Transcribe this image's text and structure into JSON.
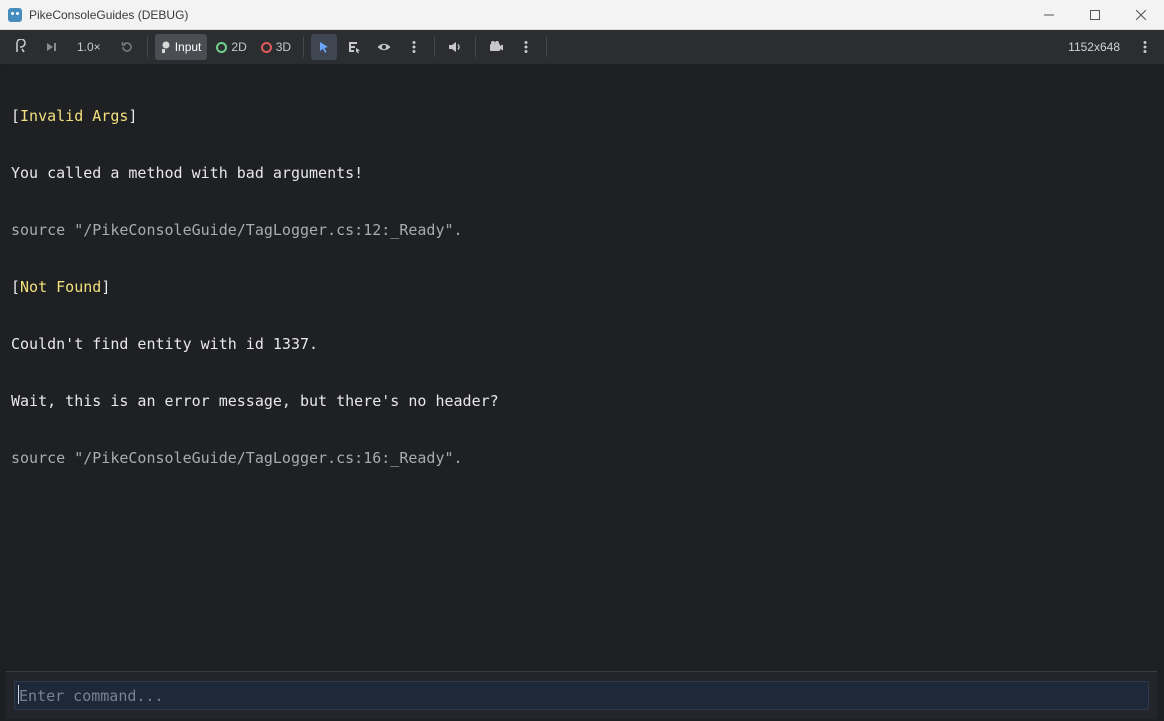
{
  "window": {
    "title": "PikeConsoleGuides (DEBUG)"
  },
  "toolbar": {
    "speed": "1.0×",
    "input_label": "Input",
    "mode_2d_label": "2D",
    "mode_3d_label": "3D",
    "resolution": "1152x648"
  },
  "colors": {
    "header_tag": "#f1e07b",
    "message": "#e8e8e8",
    "source": "#a9abb0",
    "dot_2d": "#6fcf8a",
    "dot_3d": "#e05a5a",
    "select_tool": "#6aa6ff"
  },
  "log": [
    {
      "open": "[",
      "tag": "Invalid Args",
      "close": "]"
    },
    {
      "text": "You called a method with bad arguments!"
    },
    {
      "source": "source \"/PikeConsoleGuide/TagLogger.cs:12:_Ready\"."
    },
    {
      "open": "[",
      "tag": "Not Found",
      "close": "]"
    },
    {
      "text": "Couldn't find entity with id 1337."
    },
    {
      "text": "Wait, this is an error message, but there's no header?"
    },
    {
      "source": "source \"/PikeConsoleGuide/TagLogger.cs:16:_Ready\"."
    }
  ],
  "command": {
    "placeholder": "Enter command..."
  }
}
